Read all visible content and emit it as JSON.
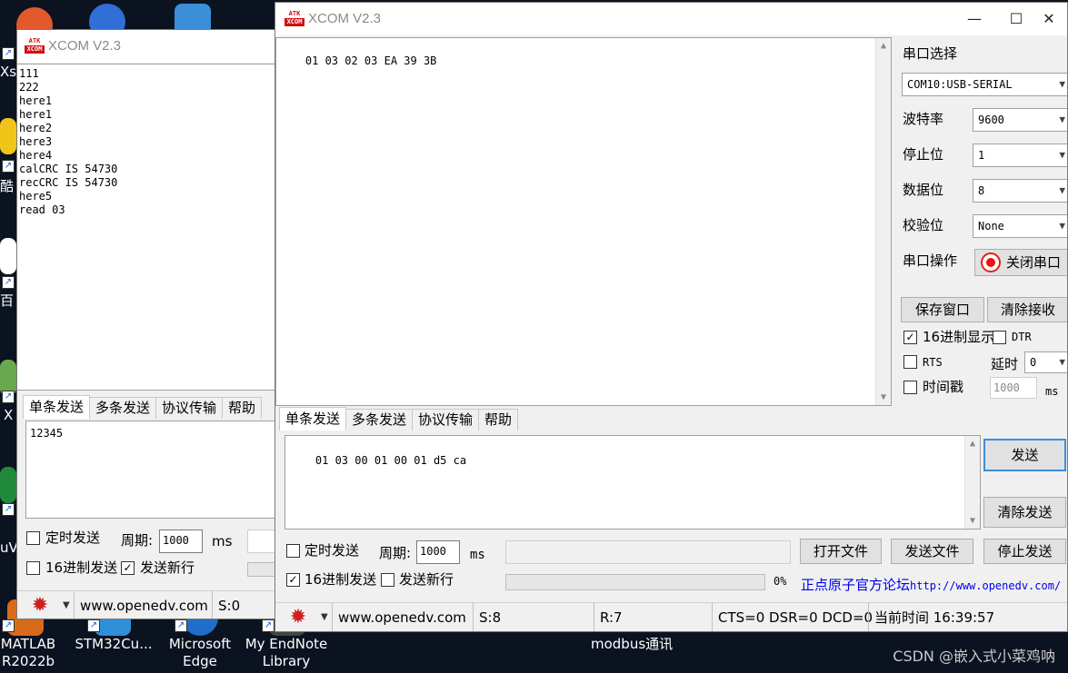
{
  "desktop": {
    "icons": [
      {
        "label": "MATLAB\nR2022b"
      },
      {
        "label": "STM32Cu..."
      },
      {
        "label": "Microsoft\nEdge"
      },
      {
        "label": "My EndNote\nLibrary"
      },
      {
        "label": "modbus通讯"
      }
    ],
    "left_partials": [
      "Xs",
      "酷",
      "百",
      "X",
      "uV"
    ],
    "watermark": "CSDN @嵌入式小菜鸡呐"
  },
  "back_window": {
    "title": "XCOM V2.3",
    "logo_top": "ATK",
    "logo_bottom": "XCOM",
    "receive_text": "111\n222\nhere1\nhere1\nhere2\nhere3\nhere4\ncalCRC IS 54730\nrecCRC IS 54730\nhere5\nread 03",
    "tabs": [
      "单条发送",
      "多条发送",
      "协议传输",
      "帮助"
    ],
    "send_text": "12345",
    "timed_send": "定时发送",
    "period_label": "周期:",
    "period_value": "1000",
    "ms": "ms",
    "hex_send": "16进制发送",
    "send_newline": "发送新行",
    "status_url": "www.openedv.com",
    "status_s": "S:0"
  },
  "main_window": {
    "title": "XCOM V2.3",
    "logo_top": "ATK",
    "logo_bottom": "XCOM",
    "controls": {
      "minimize": "—",
      "maximize": "☐",
      "close": "✕"
    },
    "receive_text": "01 03 02 03 EA 39 3B",
    "panel": {
      "port_select_label": "串口选择",
      "port_value": "COM10:USB-SERIAL",
      "baud_label": "波特率",
      "baud_value": "9600",
      "stop_label": "停止位",
      "stop_value": "1",
      "data_label": "数据位",
      "data_value": "8",
      "parity_label": "校验位",
      "parity_value": "None",
      "op_label": "串口操作",
      "close_port": "关闭串口",
      "save_window": "保存窗口",
      "clear_receive": "清除接收",
      "hex_display": "16进制显示",
      "hex_display_checked": true,
      "dtr": "DTR",
      "rts": "RTS",
      "delay_label": "延时",
      "delay_value": "0",
      "timestamp": "时间戳",
      "timestamp_value": "1000",
      "ms": "ms"
    },
    "tabs": [
      "单条发送",
      "多条发送",
      "协议传输",
      "帮助"
    ],
    "send_text": "01 03 00 01 00 01 d5 ca",
    "send_btn": "发送",
    "clear_send": "清除发送",
    "timed_send": "定时发送",
    "period_label": "周期:",
    "period_value": "1000",
    "ms": "ms",
    "open_file": "打开文件",
    "send_file": "发送文件",
    "stop_send": "停止发送",
    "hex_send": "16进制发送",
    "hex_send_checked": true,
    "send_newline": "发送新行",
    "progress_text": "0%",
    "forum_label": "正点原子官方论坛",
    "forum_url": "http://www.openedv.com/",
    "status": {
      "url": "www.openedv.com",
      "s": "S:8",
      "r": "R:7",
      "lines": "CTS=0 DSR=0 DCD=0",
      "time": "当前时间 16:39:57"
    }
  }
}
